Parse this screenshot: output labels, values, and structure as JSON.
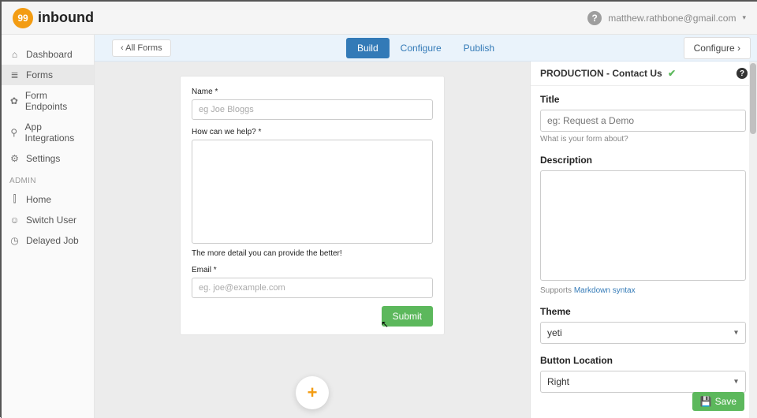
{
  "brand": {
    "badge": "99",
    "name": "inbound"
  },
  "user": {
    "email": "matthew.rathbone@gmail.com"
  },
  "sidebar": {
    "items": [
      {
        "label": "Dashboard",
        "icon": "⌂"
      },
      {
        "label": "Forms",
        "icon": "≣"
      },
      {
        "label": "Form Endpoints",
        "icon": "✿"
      },
      {
        "label": "App Integrations",
        "icon": "⚲"
      },
      {
        "label": "Settings",
        "icon": "⚙"
      }
    ],
    "admin_label": "ADMIN",
    "admin_items": [
      {
        "label": "Home",
        "icon": "⫿"
      },
      {
        "label": "Switch User",
        "icon": "☺"
      },
      {
        "label": "Delayed Job",
        "icon": "◷"
      }
    ]
  },
  "subbar": {
    "all_forms": "All Forms",
    "tabs": {
      "build": "Build",
      "configure": "Configure",
      "publish": "Publish"
    },
    "configure_btn": "Configure"
  },
  "form": {
    "name_label": "Name",
    "name_placeholder": "eg Joe Bloggs",
    "help_label": "How can we help?",
    "help_hint": "The more detail you can provide the better!",
    "email_label": "Email",
    "email_placeholder": "eg. joe@example.com",
    "submit": "Submit"
  },
  "inspector": {
    "header": "PRODUCTION - Contact Us",
    "title_label": "Title",
    "title_placeholder": "eg: Request a Demo",
    "title_hint": "What is your form about?",
    "desc_label": "Description",
    "desc_hint_pre": "Supports ",
    "desc_hint_link": "Markdown syntax",
    "theme_label": "Theme",
    "theme_value": "yeti",
    "btnloc_label": "Button Location",
    "btnloc_value": "Right",
    "save": "Save"
  }
}
